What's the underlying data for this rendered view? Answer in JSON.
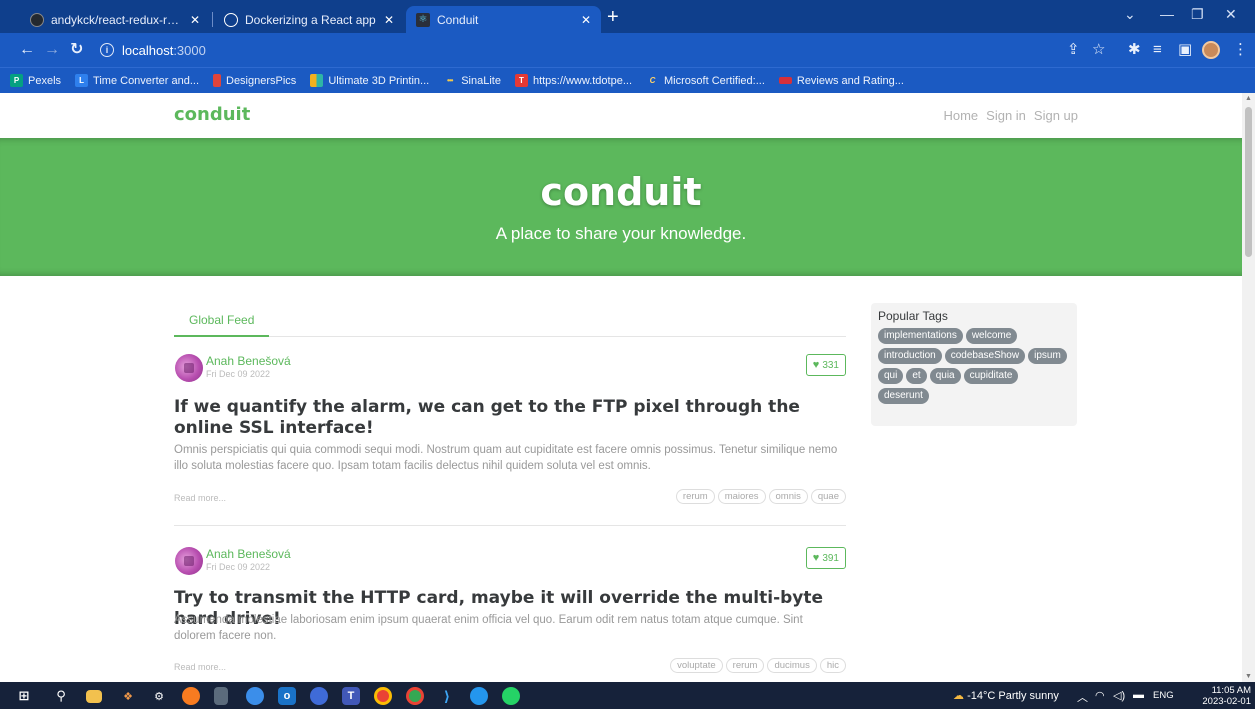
{
  "browser": {
    "tabs": [
      {
        "label": "andykck/react-redux-realworld-",
        "active": false
      },
      {
        "label": "Dockerizing a React app",
        "active": false
      },
      {
        "label": "Conduit",
        "active": true
      }
    ],
    "address": {
      "host": "localhost",
      "port": ":3000"
    },
    "bookmarks": [
      {
        "label": "Pexels",
        "icon": "P",
        "color": "#05a081"
      },
      {
        "label": "Time Converter and...",
        "icon": "L",
        "color": "#2f80ed"
      },
      {
        "label": "DesignersPics",
        "icon": "",
        "color": "#e0443a"
      },
      {
        "label": "Ultimate 3D Printin...",
        "icon": "",
        "color": "#f2b01e"
      },
      {
        "label": "SinaLite",
        "icon": "•",
        "color": "#7a53c9"
      },
      {
        "label": "https://www.tdotpe...",
        "icon": "T",
        "color": "#e53935"
      },
      {
        "label": "Microsoft Certified:...",
        "icon": "C",
        "color": "#1d4fa8"
      },
      {
        "label": "Reviews and Rating...",
        "icon": "",
        "color": "#d6303a"
      }
    ]
  },
  "app": {
    "brand": "conduit",
    "nav": [
      "Home",
      "Sign in",
      "Sign up"
    ],
    "banner": {
      "title": "conduit",
      "subtitle": "A place to share your knowledge."
    },
    "feed_tab": "Global Feed",
    "articles": [
      {
        "author": "Anah Benešová",
        "date": "Fri Dec 09 2022",
        "favorites": "331",
        "title": "If we quantify the alarm, we can get to the FTP pixel through the online SSL interface!",
        "description": "Omnis perspiciatis qui quia commodi sequi modi. Nostrum quam aut cupiditate est facere omnis possimus. Tenetur similique nemo illo soluta molestias facere quo. Ipsam totam facilis delectus nihil quidem soluta vel est omnis.",
        "read_more": "Read more...",
        "tags": [
          "rerum",
          "maiores",
          "omnis",
          "quae"
        ]
      },
      {
        "author": "Anah Benešová",
        "date": "Fri Dec 09 2022",
        "favorites": "391",
        "title": "Try to transmit the HTTP card, maybe it will override the multi-byte hard drive!",
        "description": "Assumenda molestiae laboriosam enim ipsum quaerat enim officia vel quo. Earum odit rem natus totam atque cumque. Sint dolorem facere non.",
        "read_more": "Read more...",
        "tags": [
          "voluptate",
          "rerum",
          "ducimus",
          "hic"
        ]
      }
    ],
    "popular_tags_title": "Popular Tags",
    "popular_tags": [
      "implementations",
      "welcome",
      "introduction",
      "codebaseShow",
      "ipsum",
      "qui",
      "et",
      "quia",
      "cupiditate",
      "deserunt"
    ]
  },
  "taskbar": {
    "weather": "-14°C  Partly sunny",
    "language": "ENG",
    "time": "11:05 AM",
    "date": "2023-02-01"
  },
  "colors": {
    "brand_green": "#5cb85c",
    "chrome_blue": "#1b5ac2"
  }
}
